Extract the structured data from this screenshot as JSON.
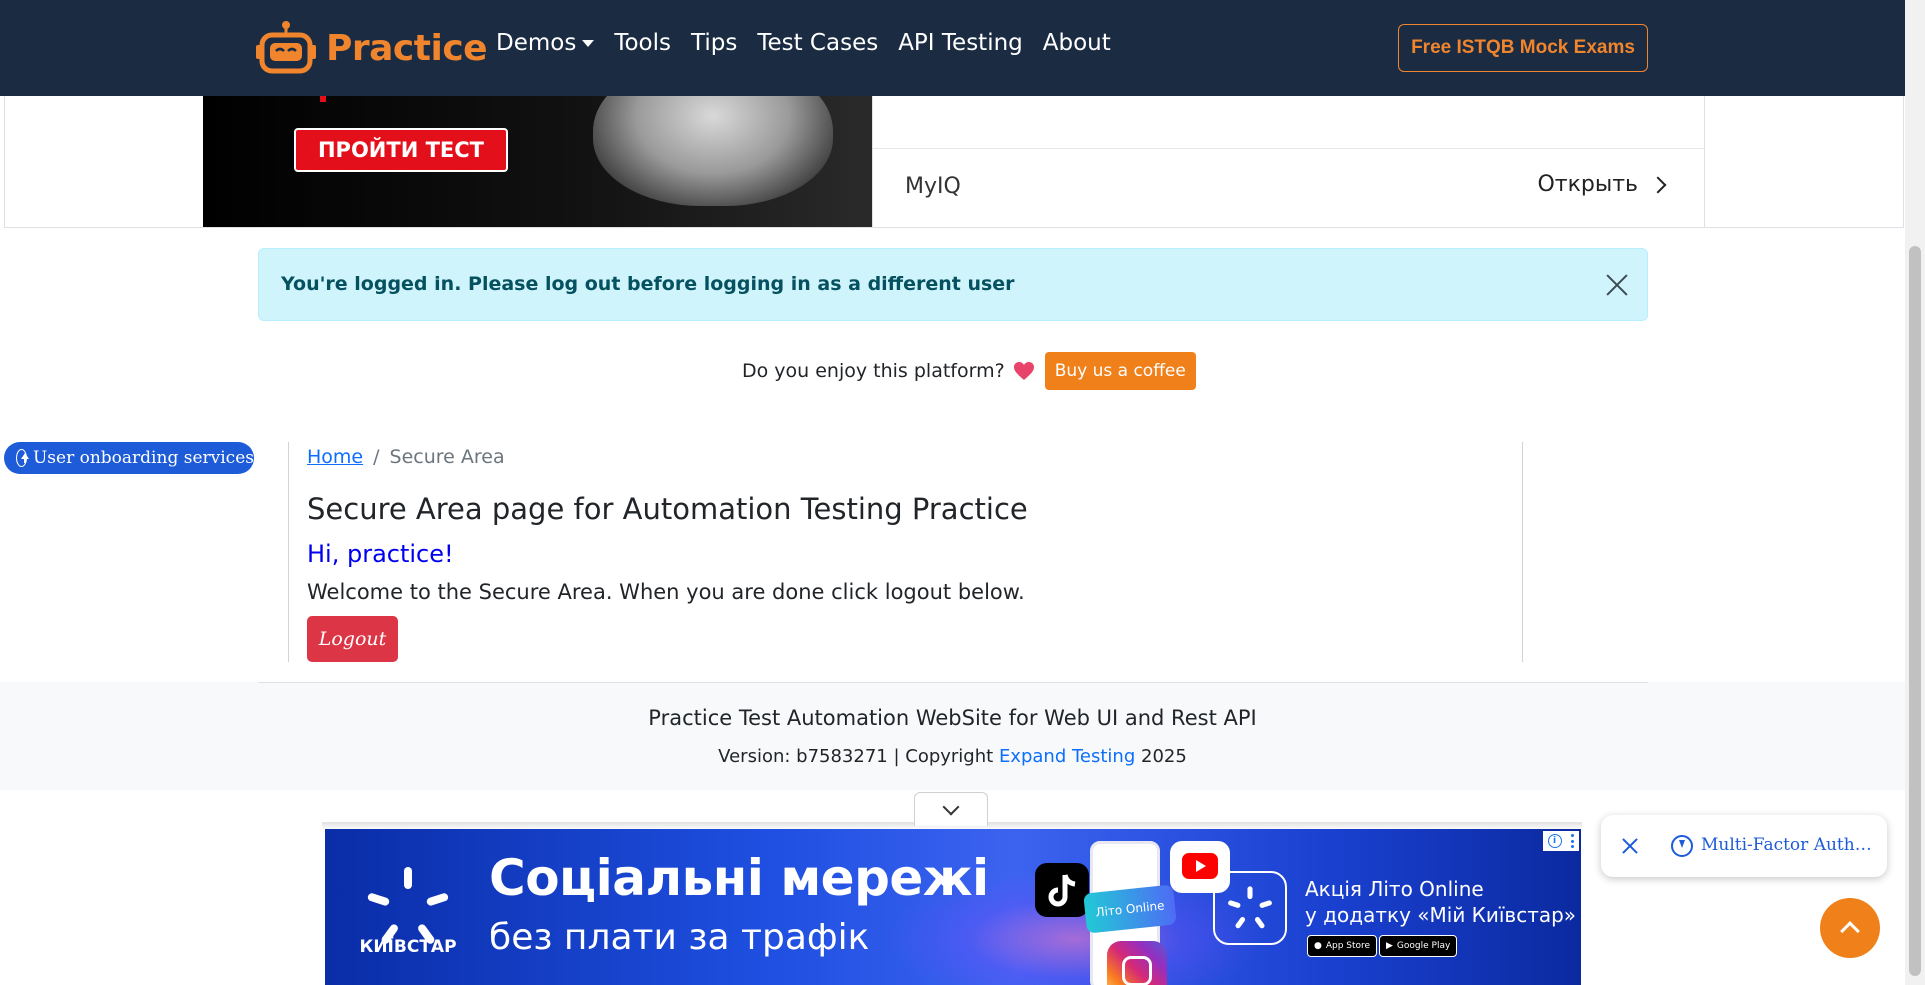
{
  "navbar": {
    "brand": "Practice",
    "links": [
      "Demos",
      "Tools",
      "Tips",
      "Test Cases",
      "API Testing",
      "About"
    ],
    "cta": "Free ISTQB Mock Exams"
  },
  "ad_top": {
    "button": "ПРОЙТИ ТЕСТ",
    "item": "MyIQ",
    "open": "Открыть"
  },
  "alert": {
    "text": "You're logged in. Please log out before logging in as a different user"
  },
  "enjoy": {
    "text": "Do you enjoy this platform?",
    "button": "Buy us a coffee"
  },
  "onboarding": {
    "label": "User onboarding services"
  },
  "breadcrumb": {
    "home": "Home",
    "separator": "/",
    "current": "Secure Area"
  },
  "main": {
    "title": "Secure Area page for Automation Testing Practice",
    "greeting": "Hi, practice!",
    "welcome": "Welcome to the Secure Area. When you are done click logout below.",
    "logout": "Logout"
  },
  "footer": {
    "title": "Practice Test Automation WebSite for Web UI and Rest API",
    "version_prefix": "Version: b7583271 | Copyright",
    "link": "Expand Testing",
    "year": "2025"
  },
  "bottom_ad": {
    "brand": "КИЇВСТАР",
    "headline": "Соціальні мережі",
    "subline": "без плати за трафік",
    "phone_label": "Літо Online",
    "promo_line1": "Акція Літо Online",
    "promo_line2": "у додатку «Мій Київстар»",
    "app_store": "App Store",
    "google_play": "Google Play"
  },
  "mfa_widget": {
    "label": "Multi-Factor Auth…"
  },
  "colors": {
    "navbar_bg": "#1a2b42",
    "brand_orange": "#f0852d",
    "alert_bg": "#cff4fc",
    "alert_text": "#055160",
    "logout_red": "#dc3545",
    "link_blue": "#0d6efd",
    "onboarding_blue": "#1d5bd8"
  },
  "icons": {
    "brand": "robot-logo-icon",
    "demos_caret": "caret-down-icon",
    "open_chevron": "chevron-right-icon",
    "alert_close": "close-icon",
    "heart": "heart-icon",
    "onboarding": "arrow-up-circle-icon",
    "ad_toggle": "chevron-down-icon",
    "mfa_close": "close-icon",
    "mfa": "bolt-circle-icon",
    "scroll_top": "chevron-up-icon"
  }
}
